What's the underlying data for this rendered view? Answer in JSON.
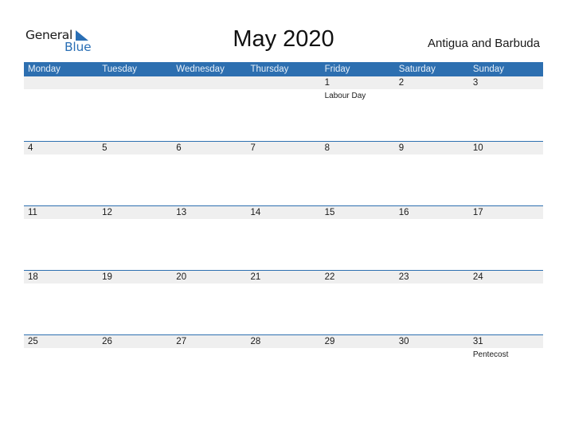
{
  "logo": {
    "text_general": "General",
    "text_blue": "Blue",
    "icon": "triangle-flag-icon",
    "accent": "#2a6fb5"
  },
  "title": "May 2020",
  "country": "Antigua and Barbuda",
  "colors": {
    "header_bg": "#2d6fb0",
    "date_band": "#efefef",
    "rule": "#2d6fb0"
  },
  "weekdays": [
    "Monday",
    "Tuesday",
    "Wednesday",
    "Thursday",
    "Friday",
    "Saturday",
    "Sunday"
  ],
  "weeks": [
    [
      {
        "day": ""
      },
      {
        "day": ""
      },
      {
        "day": ""
      },
      {
        "day": ""
      },
      {
        "day": "1",
        "holiday": "Labour Day"
      },
      {
        "day": "2"
      },
      {
        "day": "3"
      }
    ],
    [
      {
        "day": "4"
      },
      {
        "day": "5"
      },
      {
        "day": "6"
      },
      {
        "day": "7"
      },
      {
        "day": "8"
      },
      {
        "day": "9"
      },
      {
        "day": "10"
      }
    ],
    [
      {
        "day": "11"
      },
      {
        "day": "12"
      },
      {
        "day": "13"
      },
      {
        "day": "14"
      },
      {
        "day": "15"
      },
      {
        "day": "16"
      },
      {
        "day": "17"
      }
    ],
    [
      {
        "day": "18"
      },
      {
        "day": "19"
      },
      {
        "day": "20"
      },
      {
        "day": "21"
      },
      {
        "day": "22"
      },
      {
        "day": "23"
      },
      {
        "day": "24"
      }
    ],
    [
      {
        "day": "25"
      },
      {
        "day": "26"
      },
      {
        "day": "27"
      },
      {
        "day": "28"
      },
      {
        "day": "29"
      },
      {
        "day": "30"
      },
      {
        "day": "31",
        "holiday": "Pentecost"
      }
    ]
  ]
}
